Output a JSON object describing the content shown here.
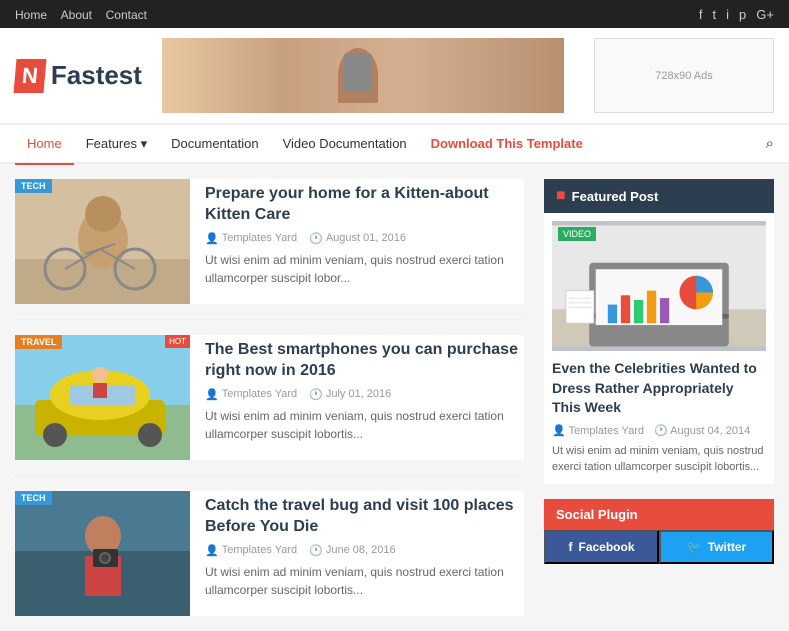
{
  "topbar": {
    "nav": [
      {
        "label": "Home",
        "active": false
      },
      {
        "label": "About",
        "active": false
      },
      {
        "label": "Contact",
        "active": false
      }
    ],
    "socials": [
      "f",
      "t",
      "i",
      "p",
      "g+"
    ]
  },
  "header": {
    "logo_text": "Fastest",
    "ad_text": "728x90 Ads"
  },
  "nav": {
    "items": [
      {
        "label": "Home",
        "active": true
      },
      {
        "label": "Features",
        "dropdown": true
      },
      {
        "label": "Documentation"
      },
      {
        "label": "Video Documentation"
      },
      {
        "label": "Download This Template",
        "accent": true
      }
    ]
  },
  "posts": [
    {
      "tag": "TECH",
      "tag_type": "tech",
      "title": "Prepare your home for a Kitten-about Kitten Care",
      "author": "Templates Yard",
      "date": "August 01, 2016",
      "excerpt": "Ut wisi enim ad minim veniam, quis nostrud exerci tation ullamcorper suscipit lobor..."
    },
    {
      "tag": "TRAVEL",
      "tag_type": "travel",
      "title": "The Best smartphones you can purchase right now in 2016",
      "author": "Templates Yard",
      "date": "July 01, 2016",
      "excerpt": "Ut wisi enim ad minim veniam, quis nostrud exerci tation ullamcorper suscipit lobortis..."
    },
    {
      "tag": "TECH",
      "tag_type": "tech",
      "title": "Catch the travel bug and visit 100 places Before You Die",
      "author": "Templates Yard",
      "date": "June 08, 2016",
      "excerpt": "Ut wisi enim ad minim veniam, quis nostrud exerci tation ullamcorper suscipit lobortis..."
    }
  ],
  "sidebar": {
    "featured_section_label": "Featured Post",
    "featured_video_tag": "VIDEO",
    "featured_title": "Even the Celebrities Wanted to Dress Rather Appropriately This Week",
    "featured_author": "Templates Yard",
    "featured_date": "August 04, 2014",
    "featured_excerpt": "Ut wisi enim ad minim veniam, quis nostrud exerci tation ullamcorper suscipit lobortis...",
    "social_plugin_label": "Social Plugin",
    "facebook_label": "Facebook",
    "twitter_label": "Twitter"
  }
}
